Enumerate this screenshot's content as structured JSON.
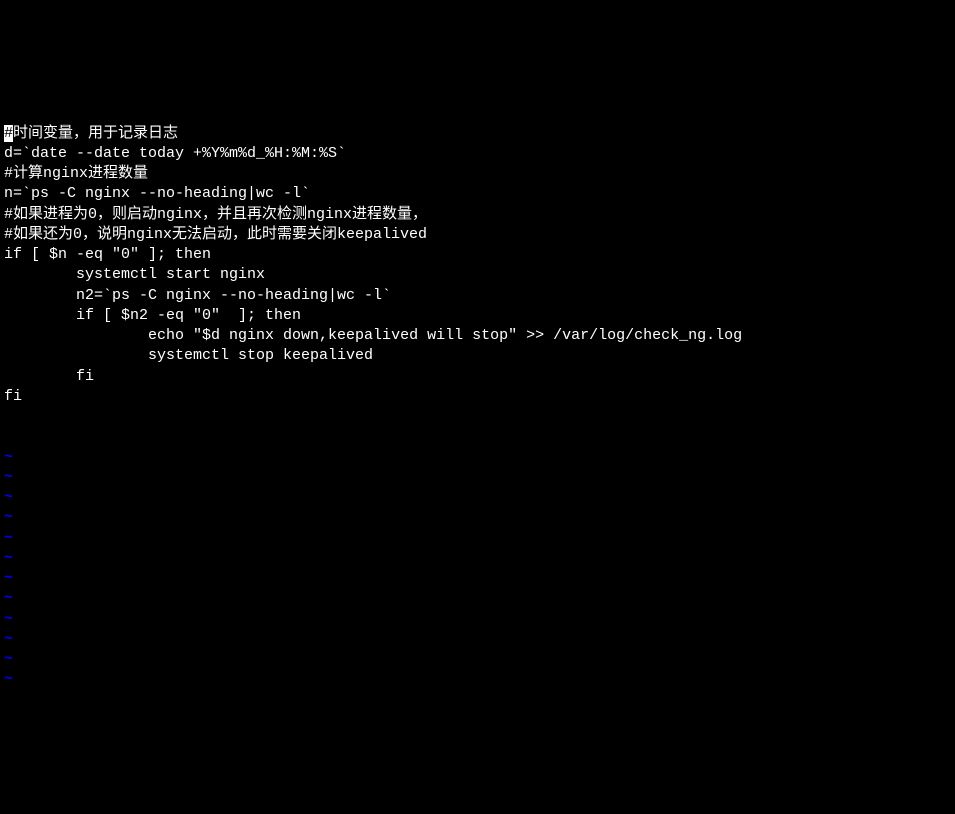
{
  "editor": {
    "lines": [
      {
        "text": "#时间变量，用于记录日志",
        "cursor_at": 0
      },
      {
        "text": "d=`date --date today +%Y%m%d_%H:%M:%S`"
      },
      {
        "text": "#计算nginx进程数量"
      },
      {
        "text": "n=`ps -C nginx --no-heading|wc -l`"
      },
      {
        "text": "#如果进程为0，则启动nginx，并且再次检测nginx进程数量，"
      },
      {
        "text": "#如果还为0，说明nginx无法启动，此时需要关闭keepalived"
      },
      {
        "text": "if [ $n -eq \"0\" ]; then"
      },
      {
        "text": "        systemctl start nginx"
      },
      {
        "text": "        n2=`ps -C nginx --no-heading|wc -l`"
      },
      {
        "text": "        if [ $n2 -eq \"0\"  ]; then"
      },
      {
        "text": "                echo \"$d nginx down,keepalived will stop\" >> /var/log/check_ng.log"
      },
      {
        "text": "                systemctl stop keepalived"
      },
      {
        "text": "        fi"
      },
      {
        "text": "fi"
      }
    ],
    "tilde": "~",
    "empty_lines": 12
  }
}
